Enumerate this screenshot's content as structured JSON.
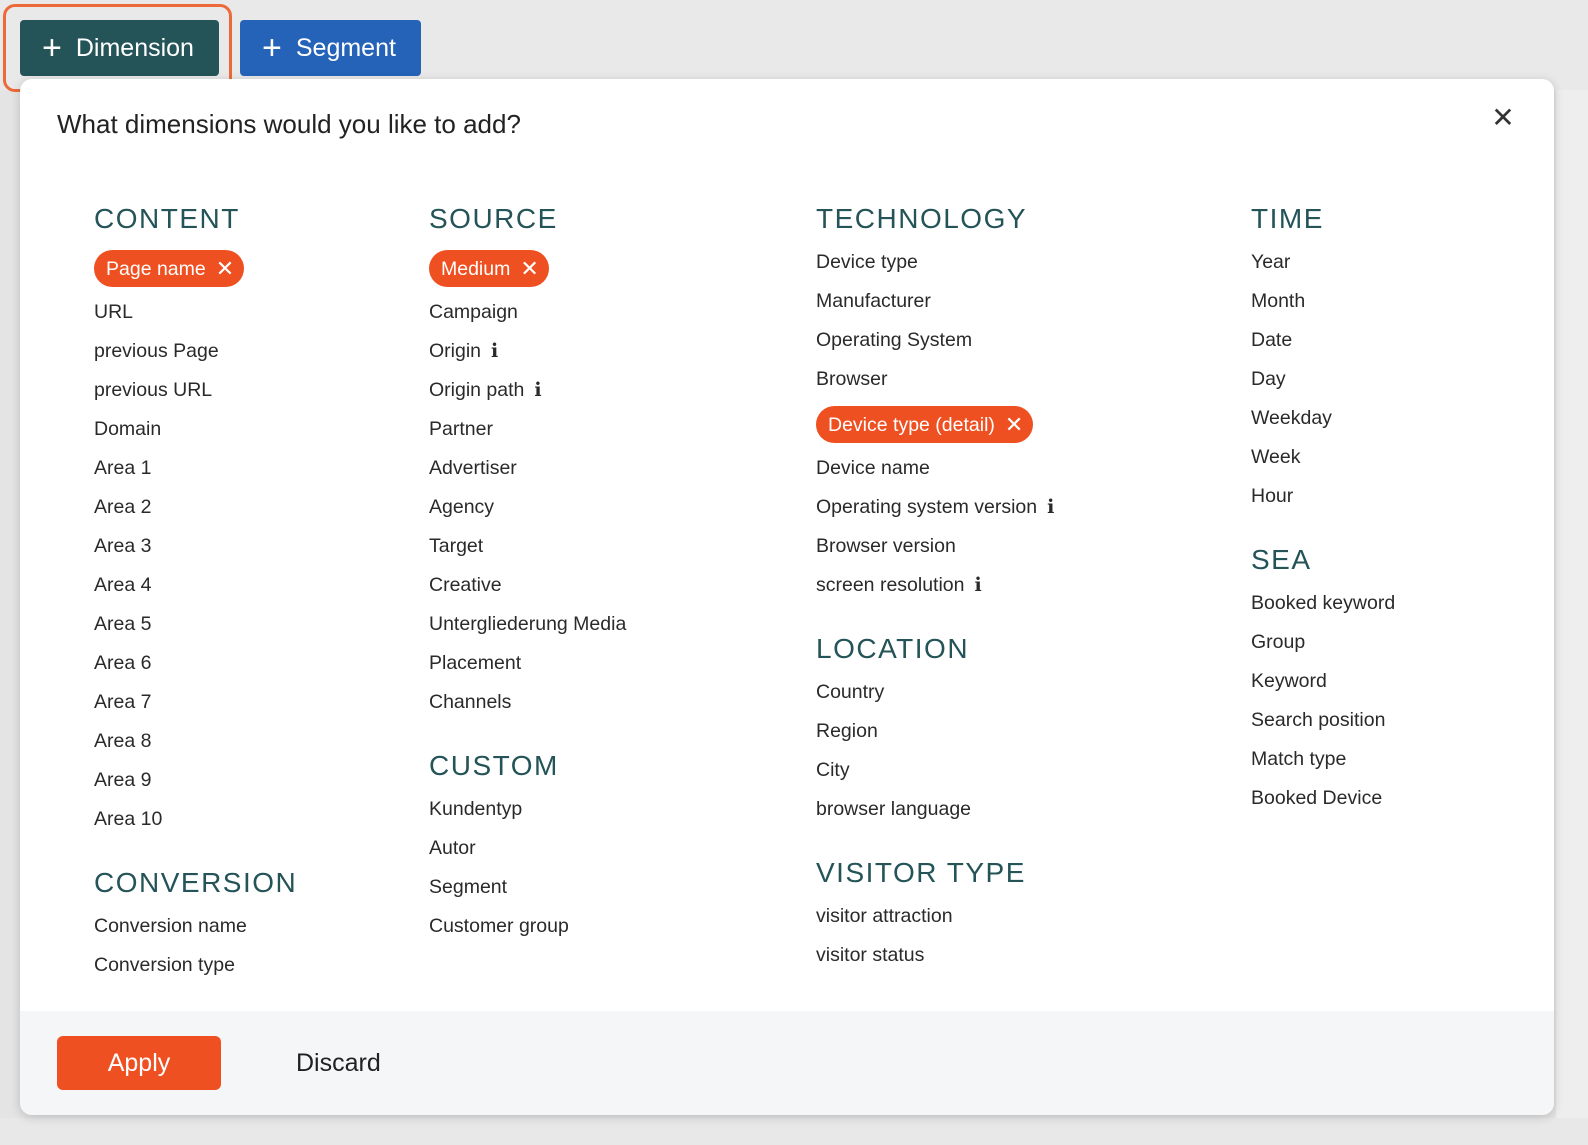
{
  "toolbar": {
    "dimension_label": "Dimension",
    "segment_label": "Segment",
    "plus_icon": "+"
  },
  "modal": {
    "title": "What dimensions would you like to add?",
    "close_icon": "✕"
  },
  "columns": {
    "content": {
      "title": "CONTENT",
      "selected": "Page name",
      "items": [
        "URL",
        "previous Page",
        "previous URL",
        "Domain",
        "Area 1",
        "Area 2",
        "Area 3",
        "Area 4",
        "Area 5",
        "Area 6",
        "Area 7",
        "Area 8",
        "Area 9",
        "Area 10"
      ]
    },
    "conversion": {
      "title": "CONVERSION",
      "items": [
        "Conversion name",
        "Conversion type"
      ]
    },
    "source": {
      "title": "SOURCE",
      "selected": "Medium",
      "items": [
        "Campaign",
        "Origin",
        "Origin path",
        "Partner",
        "Advertiser",
        "Agency",
        "Target",
        "Creative",
        "Untergliederung Media",
        "Placement",
        "Channels"
      ]
    },
    "custom": {
      "title": "CUSTOM",
      "items": [
        "Kundentyp",
        "Autor",
        "Segment",
        "Customer group"
      ]
    },
    "technology": {
      "title": "TECHNOLOGY",
      "items_before": [
        "Device type",
        "Manufacturer",
        "Operating System",
        "Browser"
      ],
      "selected": "Device type (detail)",
      "items_after": [
        "Device name",
        "Operating system version",
        "Browser version",
        "screen resolution"
      ]
    },
    "location": {
      "title": "LOCATION",
      "items": [
        "Country",
        "Region",
        "City",
        "browser language"
      ]
    },
    "visitor_type": {
      "title": "VISITOR TYPE",
      "items": [
        "visitor attraction",
        "visitor status"
      ]
    },
    "time": {
      "title": "TIME",
      "items": [
        "Year",
        "Month",
        "Date",
        "Day",
        "Weekday",
        "Week",
        "Hour"
      ]
    },
    "sea": {
      "title": "SEA",
      "items": [
        "Booked keyword",
        "Group",
        "Keyword",
        "Search position",
        "Match type",
        "Booked Device"
      ]
    }
  },
  "info_icon": "i",
  "chip_remove_icon": "✕",
  "footer": {
    "apply_label": "Apply",
    "discard_label": "Discard"
  },
  "colors": {
    "accent": "#ef5021",
    "section_title": "#245458",
    "dimension_button": "#245458",
    "segment_button": "#2563b8",
    "highlight_ring": "#ec6a3a"
  }
}
